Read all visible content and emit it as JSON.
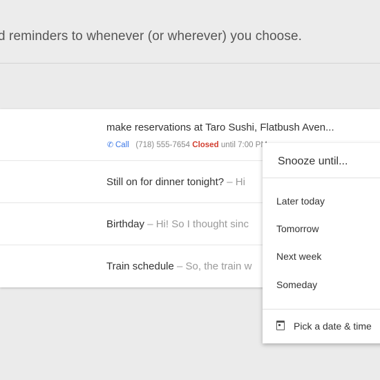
{
  "header": {
    "headline": "d reminders to whenever (or wherever) you choose."
  },
  "inbox": {
    "reminder": {
      "subject": "make reservations at Taro Sushi, Flatbush Aven...",
      "call_label": "Call",
      "phone": "(718) 555-7654",
      "status": "Closed",
      "hours": "until 7:00 PM"
    },
    "messages": [
      {
        "subject": "Still on for dinner tonight?",
        "snippet": " – Hi"
      },
      {
        "subject": "Birthday",
        "snippet": " – Hi! So I thought sinc"
      },
      {
        "subject": "Train schedule",
        "snippet": " – So, the train w"
      }
    ]
  },
  "snooze_menu": {
    "title": "Snooze until...",
    "options": [
      "Later today",
      "Tomorrow",
      "Next week",
      "Someday"
    ],
    "pick_date_label": "Pick a date & time",
    "icons": {
      "phone": "phone-icon",
      "calendar": "calendar-icon"
    }
  }
}
